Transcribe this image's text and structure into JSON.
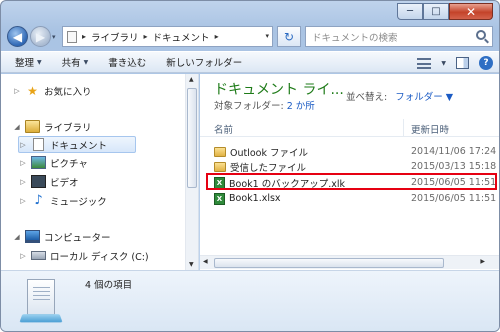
{
  "titlebar": {
    "minimize_label": "─",
    "maximize_label": "□",
    "close_label": "✕"
  },
  "address": {
    "sep1": "▸",
    "crumb1": "ライブラリ",
    "sep2": "▸",
    "crumb2": "ドキュメント",
    "sep3": "▸",
    "dropdown": "▾"
  },
  "search": {
    "placeholder": "ドキュメントの検索"
  },
  "nav": {
    "back": "◀",
    "forward": "▶",
    "history": "▾",
    "refresh": "↻"
  },
  "toolbar": {
    "organize": "整理",
    "share": "共有",
    "burn": "書き込む",
    "new_folder": "新しいフォルダー",
    "dropdown_glyph": "▼",
    "help": "?"
  },
  "navpane": {
    "favorites": "お気に入り",
    "libraries": "ライブラリ",
    "documents": "ドキュメント",
    "pictures": "ピクチャ",
    "videos": "ビデオ",
    "music": "ミュージック",
    "computer": "コンピューター",
    "local_disk": "ローカル ディスク (C:)",
    "collapsed": "▷",
    "expanded": "◢",
    "star": "★",
    "note": "♪"
  },
  "library": {
    "title": "ドキュメント ライ...",
    "subtitle_prefix": "対象フォルダー:",
    "subtitle_link": "2 か所",
    "arrange_label": "並べ替え:",
    "arrange_value": "フォルダー ▼"
  },
  "columns": {
    "name": "名前",
    "modified": "更新日時"
  },
  "files": [
    {
      "name": "Outlook ファイル",
      "date": "2014/11/06 17:24"
    },
    {
      "name": "受信したファイル",
      "date": "2015/03/13 15:18"
    },
    {
      "name": "Book1 のバックアップ.xlk",
      "date": "2015/06/05 11:51"
    },
    {
      "name": "Book1.xlsx",
      "date": "2015/06/05 11:51"
    }
  ],
  "excel_glyph": "X",
  "scroll": {
    "up": "▲",
    "down": "▼",
    "left": "◀",
    "right": "▶"
  },
  "details": {
    "count_text": "4 個の項目"
  }
}
